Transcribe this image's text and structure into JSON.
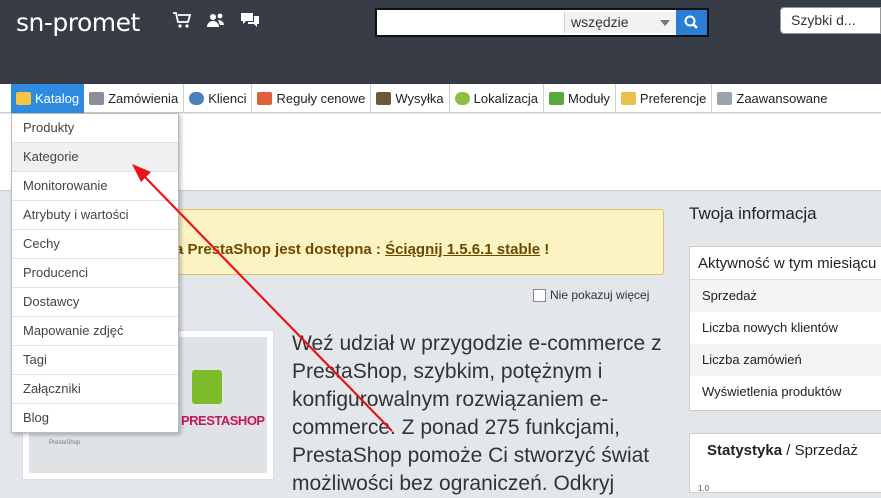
{
  "header": {
    "brand": "sn-promet",
    "icons": [
      "cart-icon",
      "users-icon",
      "messages-icon"
    ],
    "search": {
      "value": "",
      "scope": "wszędzie"
    },
    "shortcut": "Szybki d..."
  },
  "nav": {
    "tabs": [
      {
        "label": "Katalog",
        "icon": "folder-icon",
        "active": true
      },
      {
        "label": "Zamówienia",
        "icon": "cart-icon"
      },
      {
        "label": "Klienci",
        "icon": "user-icon"
      },
      {
        "label": "Reguły cenowe",
        "icon": "price-rules-icon"
      },
      {
        "label": "Wysyłka",
        "icon": "truck-icon"
      },
      {
        "label": "Lokalizacja",
        "icon": "globe-icon"
      },
      {
        "label": "Moduły",
        "icon": "puzzle-icon"
      },
      {
        "label": "Preferencje",
        "icon": "preferences-icon"
      },
      {
        "label": "Zaawansowane",
        "icon": "wrench-icon"
      }
    ]
  },
  "dropdown": {
    "items": [
      "Produkty",
      "Kategorie",
      "Monitorowanie",
      "Atrybuty i wartości",
      "Cechy",
      "Producenci",
      "Dostawcy",
      "Mapowanie zdjęć",
      "Tagi",
      "Załączniki",
      "Blog"
    ],
    "highlighted": "Kategorie"
  },
  "notice": {
    "text": "a PrestaShop jest dostępna : ",
    "link": "Ściągnij 1.5.6.1 stable",
    "suffix": " !"
  },
  "noshow_label": "Nie pokazuj więcej",
  "ad": {
    "logo": "PRESTASHOP",
    "small": "PrestaShop",
    "text": "Weź udział w przygodzie e-commerce z PrestaShop, szybkim, potężnym i konfigurowalnym rozwiązaniem e-commerce. Z ponad 275 funkcjami, PrestaShop pomoże Ci stworzyć świat możliwości bez ograniczeń. Odkryj"
  },
  "right": {
    "title": "Twoja informacja",
    "activity_header": "Aktywność w tym miesiącu",
    "rows": [
      "Sprzedaż",
      "Liczba nowych klientów",
      "Liczba zamówień",
      "Wyświetlenia produktów"
    ],
    "stats_title": "Statystyka",
    "stats_sub": "Sprzedaż",
    "stats_axis": "1.0"
  },
  "colors": {
    "topbar": "#383c46",
    "active_tab": "#2f8be0",
    "search_button": "#2a7fd4",
    "annotation_arrow": "#e8141b"
  }
}
